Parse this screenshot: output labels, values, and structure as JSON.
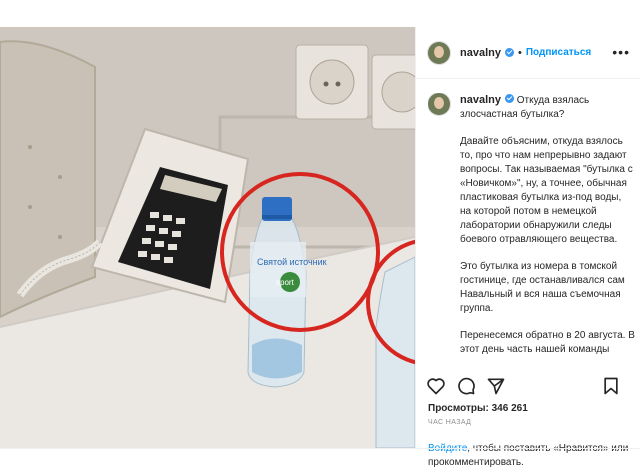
{
  "post": {
    "username": "navalny",
    "follow_label": "Подписаться",
    "more_label": "•••",
    "caption": {
      "first_line": "Откуда взялась злосчастная бутылка?",
      "paragraphs": [
        "Давайте объясним, откуда взялось то, про что нам непрерывно задают вопросы. Так называемая \"бутылка с «Новичком»\", ну, а точнее, обычная пластиковая бутылка из-под воды, на которой потом в немецкой лаборатории обнаружили следы боевого отравляющего вещества.",
        "Это бутылка из номера в томской гостинице, где останавливался сам Навальный и вся наша съемочная группа.",
        "Перенесемся обратно в 20 августа. В этот день часть нашей команды"
      ]
    },
    "views_label": "Просмотры:",
    "views_count": "346 261",
    "time_ago": "ЧАС НАЗАД",
    "login_link": "Войдите",
    "login_text": ", чтобы поставить «Нравится» или прокомментировать."
  },
  "media": {
    "bottle_label_text": "Святой источник",
    "bottle_label_text2": "sport",
    "highlight_color": "#d7261f"
  },
  "icons": [
    "heart-icon",
    "comment-icon",
    "share-icon",
    "bookmark-icon",
    "verified-badge-icon"
  ]
}
